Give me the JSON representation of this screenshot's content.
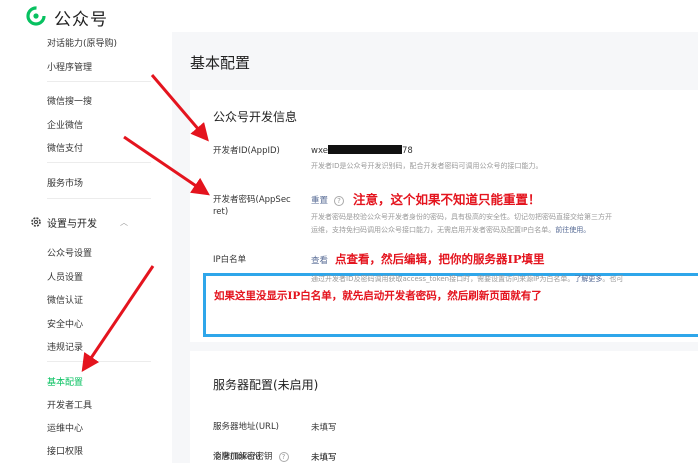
{
  "header": {
    "brand": "公众号"
  },
  "sidebar": {
    "top_items": [
      {
        "label": "对话能力(原导购)"
      },
      {
        "label": "小程序管理"
      },
      {
        "label": "微信搜一搜"
      },
      {
        "label": "企业微信"
      },
      {
        "label": "微信支付"
      },
      {
        "label": "服务市场"
      }
    ],
    "group": {
      "label": "设置与开发",
      "icon": "gear-icon"
    },
    "group_items": [
      {
        "label": "公众号设置"
      },
      {
        "label": "人员设置"
      },
      {
        "label": "微信认证"
      },
      {
        "label": "安全中心"
      },
      {
        "label": "违规记录"
      },
      {
        "label": "基本配置",
        "active": true
      },
      {
        "label": "开发者工具"
      },
      {
        "label": "运维中心"
      },
      {
        "label": "接口权限"
      }
    ]
  },
  "main": {
    "page_title": "基本配置",
    "dev_info": {
      "title": "公众号开发信息",
      "appid_label": "开发者ID(AppID)",
      "appid_prefix": "wxe",
      "appid_suffix": "78",
      "appid_desc": "开发者ID是公众号开发识别码，配合开发者密码可调用公众号的接口能力。",
      "secret_label_1": "开发者密码(AppSec",
      "secret_label_2": "ret)",
      "secret_action": "重置",
      "secret_note": "注意，这个如果不知道只能重置！",
      "secret_desc_1": "开发者密码是校验公众号开发者身份的密码，具有极高的安全性。切记勿把密码直接交给第三方开",
      "secret_desc_2a": "运维，支持免扫码调用公众号接口能力，无需启用开发者密码及配置IP白名单。",
      "secret_desc_2b": "前往使用。",
      "ip_label": "IP白名单",
      "ip_action": "查看",
      "ip_note": "点查看，然后编辑，把你的服务器IP填里",
      "ip_desc_a": "通过开发者ID及密码调用获取access_token接口时，需要设置访问来源IP为白名单。",
      "ip_desc_b": "了解更多",
      "ip_desc_c": "。也可",
      "bottom_note": "如果这里没显示IP白名单，就先启动开发者密码，然后刷新页面就有了"
    },
    "server_config": {
      "title": "服务器配置(未启用)",
      "rows": [
        {
          "label": "服务器地址(URL)",
          "value": "未填写"
        },
        {
          "label": "令牌(Token)",
          "value": "未填写"
        },
        {
          "label": "消息加解密密钥",
          "value": "未填写"
        }
      ]
    }
  },
  "colors": {
    "accent": "#07c160",
    "annotation": "#e4141e",
    "highlight_box": "#2ea6ea",
    "link": "#576b95"
  }
}
